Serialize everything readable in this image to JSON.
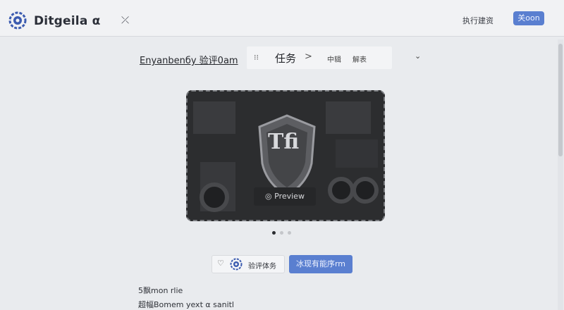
{
  "header": {
    "app_title": "Ditgeila α",
    "pin_glyph": "⤫",
    "top_link": "执行建资",
    "top_button": "关oon"
  },
  "breadcrumb": {
    "link": "Enyanbenбу 验评0am",
    "separator_glyph": "⁝⁝",
    "task": "任务",
    "arrow": ">",
    "mid": "中辑",
    "end": "解表",
    "chevron": "⌄"
  },
  "preview": {
    "label": "◎ Preview",
    "shield_text": "Tfi"
  },
  "carousel": {
    "active_index": 0,
    "count": 3,
    "active_color": "#2a2c30",
    "inactive_color": "#c4c6ca"
  },
  "actions": {
    "heart_glyph": "♡",
    "group_label": "验评体务",
    "primary_label": "冰现有能序rm"
  },
  "info": {
    "line1": "5飘mon rlie",
    "line2": "超幅Bomem yext α sanitl"
  },
  "colors": {
    "accent": "#5a7fd0",
    "logo": "#3b5bb0"
  }
}
